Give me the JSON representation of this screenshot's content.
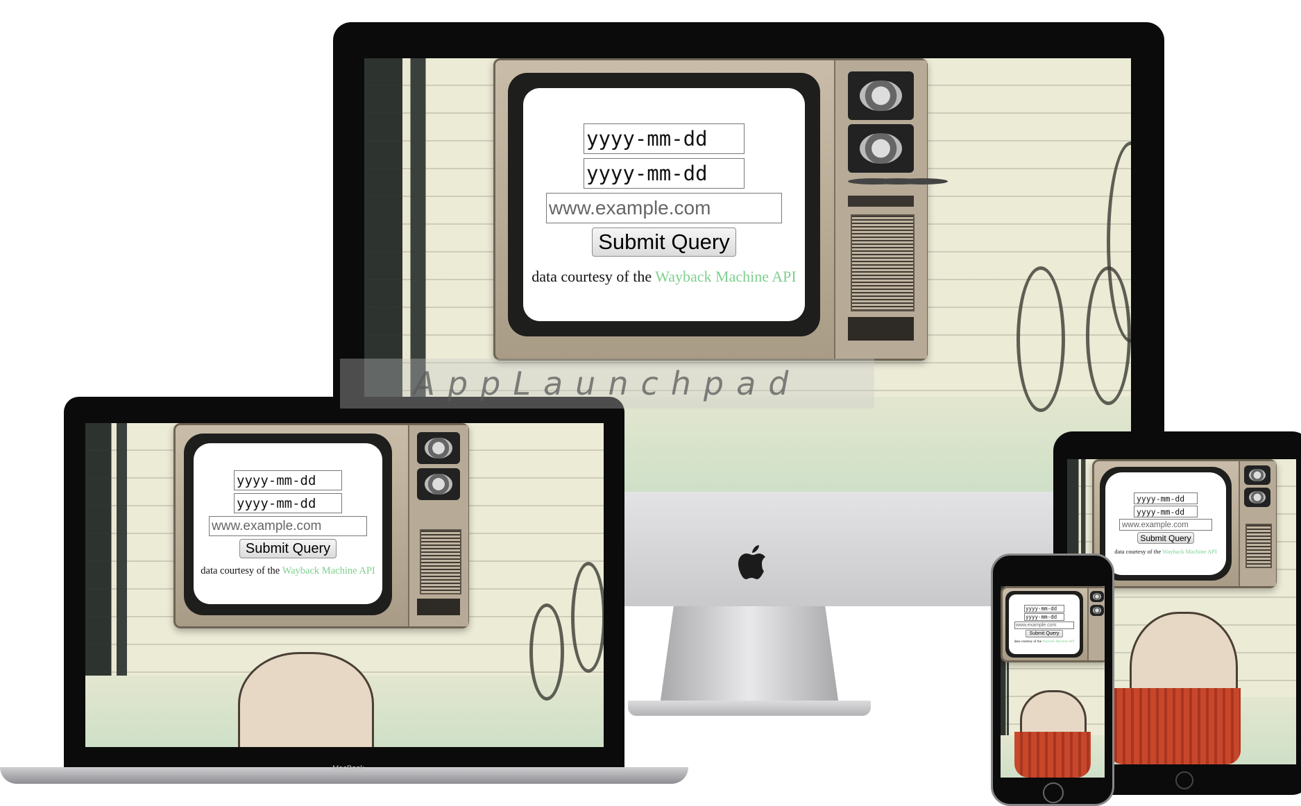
{
  "form": {
    "date_placeholder_1": "yyyy-mm-dd",
    "date_placeholder_2": "yyyy-mm-dd",
    "url_placeholder": "www.example.com",
    "submit_label": "Submit Query",
    "credit_prefix": "data courtesy of the",
    "credit_link": "Wayback Machine API"
  },
  "devices": {
    "laptop_label": "MacBook"
  },
  "watermark": "AppLaunchpad",
  "colors": {
    "link": "#7fcf8f",
    "device_bezel": "#0b0b0b"
  }
}
